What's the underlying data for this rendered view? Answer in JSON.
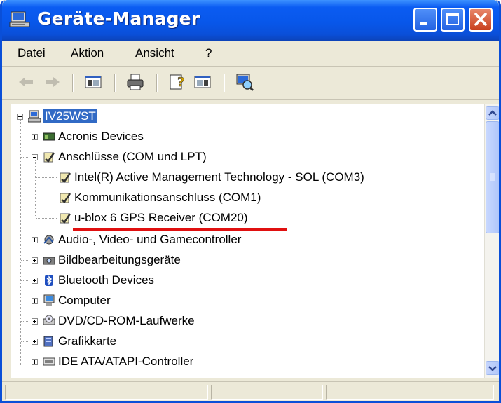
{
  "window": {
    "title": "Geräte-Manager"
  },
  "menu": {
    "items": [
      "Datei",
      "Aktion",
      "Ansicht",
      "?"
    ]
  },
  "toolbar": {
    "buttons": [
      "back-arrow",
      "forward-arrow",
      "show-hide-console-tree",
      "print",
      "properties-help",
      "view-pane",
      "scan-hardware"
    ]
  },
  "tree": {
    "root": "IV25WST",
    "categories": [
      "Acronis Devices",
      "Anschlüsse (COM und LPT)",
      "Audio-, Video- und Gamecontroller",
      "Bildbearbeitungsgeräte",
      "Bluetooth Devices",
      "Computer",
      "DVD/CD-ROM-Laufwerke",
      "Grafikkarte",
      "IDE ATA/ATAPI-Controller"
    ],
    "ports_children": [
      "Intel(R) Active Management Technology - SOL (COM3)",
      "Kommunikationsanschluss (COM1)",
      "u-blox 6 GPS Receiver (COM20)"
    ],
    "highlight_color": "#e01010"
  }
}
